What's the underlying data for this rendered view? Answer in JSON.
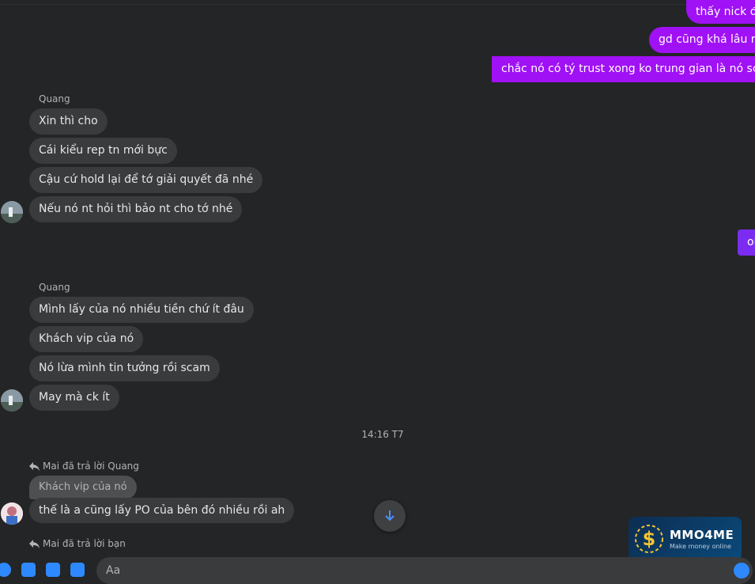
{
  "outgoing": [
    {
      "text": "thấy nick đó"
    },
    {
      "text": "gd cũng khá lâu rồi"
    },
    {
      "text": "chắc nó có tý trust xong ko trung gian là nó scam"
    },
    {
      "text": "ok"
    }
  ],
  "group1": {
    "sender": "Quang",
    "messages": [
      {
        "text": "Xin thì cho"
      },
      {
        "text": "Cái kiểu rep tn mới bực"
      },
      {
        "text": "Cậu cứ hold lại để tớ giải quyết đã nhé"
      },
      {
        "text": "Nếu nó nt hỏi thì bảo nt cho tớ nhé"
      }
    ]
  },
  "group2": {
    "sender": "Quang",
    "messages": [
      {
        "text": "Mình lấy của nó nhiều tiền chứ ít đâu"
      },
      {
        "text": "Khách vip của nó"
      },
      {
        "text": "Nó lừa mình tin tưởng rồi scam"
      },
      {
        "text": "May mà ck ít"
      }
    ]
  },
  "timestamp": "14:16 T7",
  "reply1": {
    "label": "Mai đã trả lời Quang",
    "quote": "Khách vip của nó",
    "message": "thế là a cũng lấy PO của bên đó nhiều rồi ah"
  },
  "reply2": {
    "label": "Mai đã trả lời bạn"
  },
  "composer": {
    "placeholder": "Aa"
  },
  "watermark": {
    "title": "MMO4ME",
    "subtitle": "Make money online"
  },
  "colors": {
    "outgoing_bubble": "#a011f5",
    "outgoing_bubble_alt": "#7b2cf0",
    "incoming_bubble": "#3a3b3c",
    "background": "#242526"
  }
}
